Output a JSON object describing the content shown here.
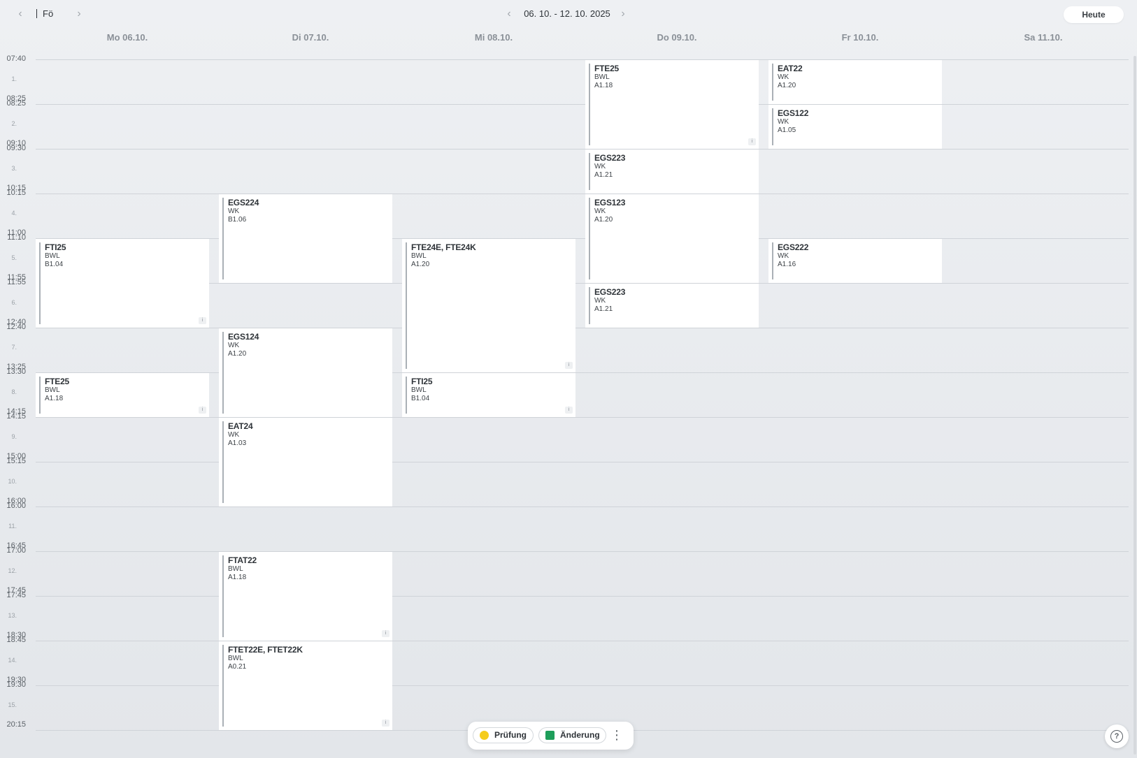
{
  "header": {
    "prev_label": "‹",
    "next_label": "›",
    "class_name": "Fö",
    "week_prev": "‹",
    "week_next": "›",
    "week_range": "06. 10. - 12. 10. 2025",
    "today_label": "Heute"
  },
  "days": [
    "Mo 06.10.",
    "Di 07.10.",
    "Mi 08.10.",
    "Do 09.10.",
    "Fr 10.10.",
    "Sa 11.10."
  ],
  "periods": [
    {
      "num": "1.",
      "start": "07:40",
      "end": "08:25"
    },
    {
      "num": "2.",
      "start": "08:25",
      "end": "09:10"
    },
    {
      "num": "3.",
      "start": "09:30",
      "end": "10:15"
    },
    {
      "num": "4.",
      "start": "10:15",
      "end": "11:00"
    },
    {
      "num": "5.",
      "start": "11:10",
      "end": "11:55"
    },
    {
      "num": "6.",
      "start": "11:55",
      "end": "12:40"
    },
    {
      "num": "7.",
      "start": "12:40",
      "end": "13:25"
    },
    {
      "num": "8.",
      "start": "13:30",
      "end": "14:15"
    },
    {
      "num": "9.",
      "start": "14:15",
      "end": "15:00"
    },
    {
      "num": "10.",
      "start": "15:15",
      "end": "16:00"
    },
    {
      "num": "11.",
      "start": "16:00",
      "end": "16:45"
    },
    {
      "num": "12.",
      "start": "17:00",
      "end": "17:45"
    },
    {
      "num": "13.",
      "start": "17:45",
      "end": "18:30"
    },
    {
      "num": "14.",
      "start": "18:45",
      "end": "19:30"
    },
    {
      "num": "15.",
      "start": "19:30",
      "end": "20:15"
    }
  ],
  "lessons": [
    {
      "day": 0,
      "start": 5,
      "span": 2,
      "subject": "FTI25",
      "teacher": "BWL",
      "room": "B1.04",
      "info": true
    },
    {
      "day": 0,
      "start": 8,
      "span": 1,
      "subject": "FTE25",
      "teacher": "BWL",
      "room": "A1.18",
      "info": true
    },
    {
      "day": 1,
      "start": 4,
      "span": 2,
      "subject": "EGS224",
      "teacher": "WK",
      "room": "B1.06",
      "info": false
    },
    {
      "day": 1,
      "start": 7,
      "span": 2,
      "subject": "EGS124",
      "teacher": "WK",
      "room": "A1.20",
      "info": false
    },
    {
      "day": 1,
      "start": 9,
      "span": 2,
      "subject": "EAT24",
      "teacher": "WK",
      "room": "A1.03",
      "info": false
    },
    {
      "day": 1,
      "start": 12,
      "span": 2,
      "subject": "FTAT22",
      "teacher": "BWL",
      "room": "A1.18",
      "info": true
    },
    {
      "day": 1,
      "start": 14,
      "span": 2,
      "subject": "FTET22E, FTET22K",
      "teacher": "BWL",
      "room": "A0.21",
      "info": true
    },
    {
      "day": 2,
      "start": 5,
      "span": 3,
      "subject": "FTE24E, FTE24K",
      "teacher": "BWL",
      "room": "A1.20",
      "info": true
    },
    {
      "day": 2,
      "start": 8,
      "span": 1,
      "subject": "FTI25",
      "teacher": "BWL",
      "room": "B1.04",
      "info": true
    },
    {
      "day": 3,
      "start": 1,
      "span": 2,
      "subject": "FTE25",
      "teacher": "BWL",
      "room": "A1.18",
      "info": true
    },
    {
      "day": 3,
      "start": 3,
      "span": 1,
      "subject": "EGS223",
      "teacher": "WK",
      "room": "A1.21",
      "info": false
    },
    {
      "day": 3,
      "start": 4,
      "span": 2,
      "subject": "EGS123",
      "teacher": "WK",
      "room": "A1.20",
      "info": false
    },
    {
      "day": 3,
      "start": 6,
      "span": 1,
      "subject": "EGS223",
      "teacher": "WK",
      "room": "A1.21",
      "info": false
    },
    {
      "day": 4,
      "start": 1,
      "span": 1,
      "subject": "EAT22",
      "teacher": "WK",
      "room": "A1.20",
      "info": false
    },
    {
      "day": 4,
      "start": 2,
      "span": 1,
      "subject": "EGS122",
      "teacher": "WK",
      "room": "A1.05",
      "info": false
    },
    {
      "day": 4,
      "start": 5,
      "span": 1,
      "subject": "EGS222",
      "teacher": "WK",
      "room": "A1.16",
      "info": false
    }
  ],
  "info_glyph": "i",
  "legend": {
    "exam_label": "Prüfung",
    "exam_color": "#f5cc1c",
    "change_label": "Änderung",
    "change_color": "#1e9e5a",
    "more_glyph": "⋮"
  },
  "help_glyph": "?"
}
